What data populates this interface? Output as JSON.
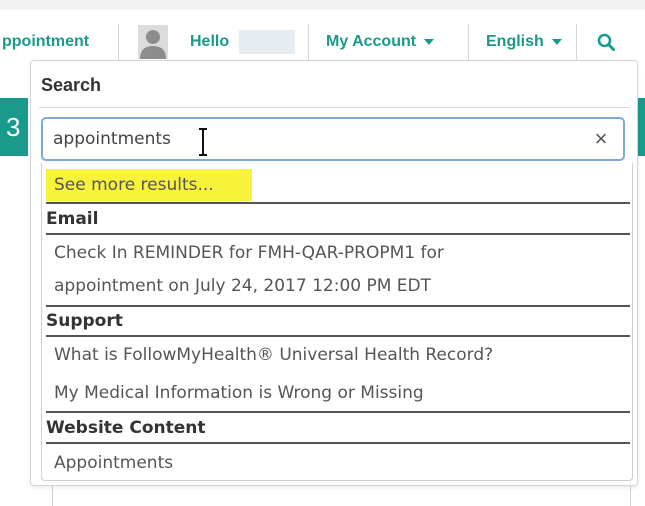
{
  "nav": {
    "appointment_label": "ppointment",
    "hello_label": "Hello",
    "my_account_label": "My Account",
    "language_label": "English",
    "search_icon": "search-icon",
    "avatar_icon": "user-avatar-icon",
    "accent_color": "#1a9a8a"
  },
  "background": {
    "partial_text": "3"
  },
  "search_panel": {
    "title": "Search",
    "query": "appointments",
    "clear_icon": "close-icon",
    "clear_glyph": "×",
    "see_more": "See more results...",
    "highlight_color": "#f7f33a",
    "groups": [
      {
        "heading": "Email",
        "items": [
          "Check In REMINDER for FMH-QAR-PROPM1 for",
          "appointment on July 24, 2017 12:00 PM EDT"
        ]
      },
      {
        "heading": "Support",
        "items": [
          "What is FollowMyHealth® Universal Health Record?",
          "My Medical Information is Wrong or Missing"
        ]
      },
      {
        "heading": "Website Content",
        "items": [
          "Appointments"
        ]
      }
    ]
  }
}
